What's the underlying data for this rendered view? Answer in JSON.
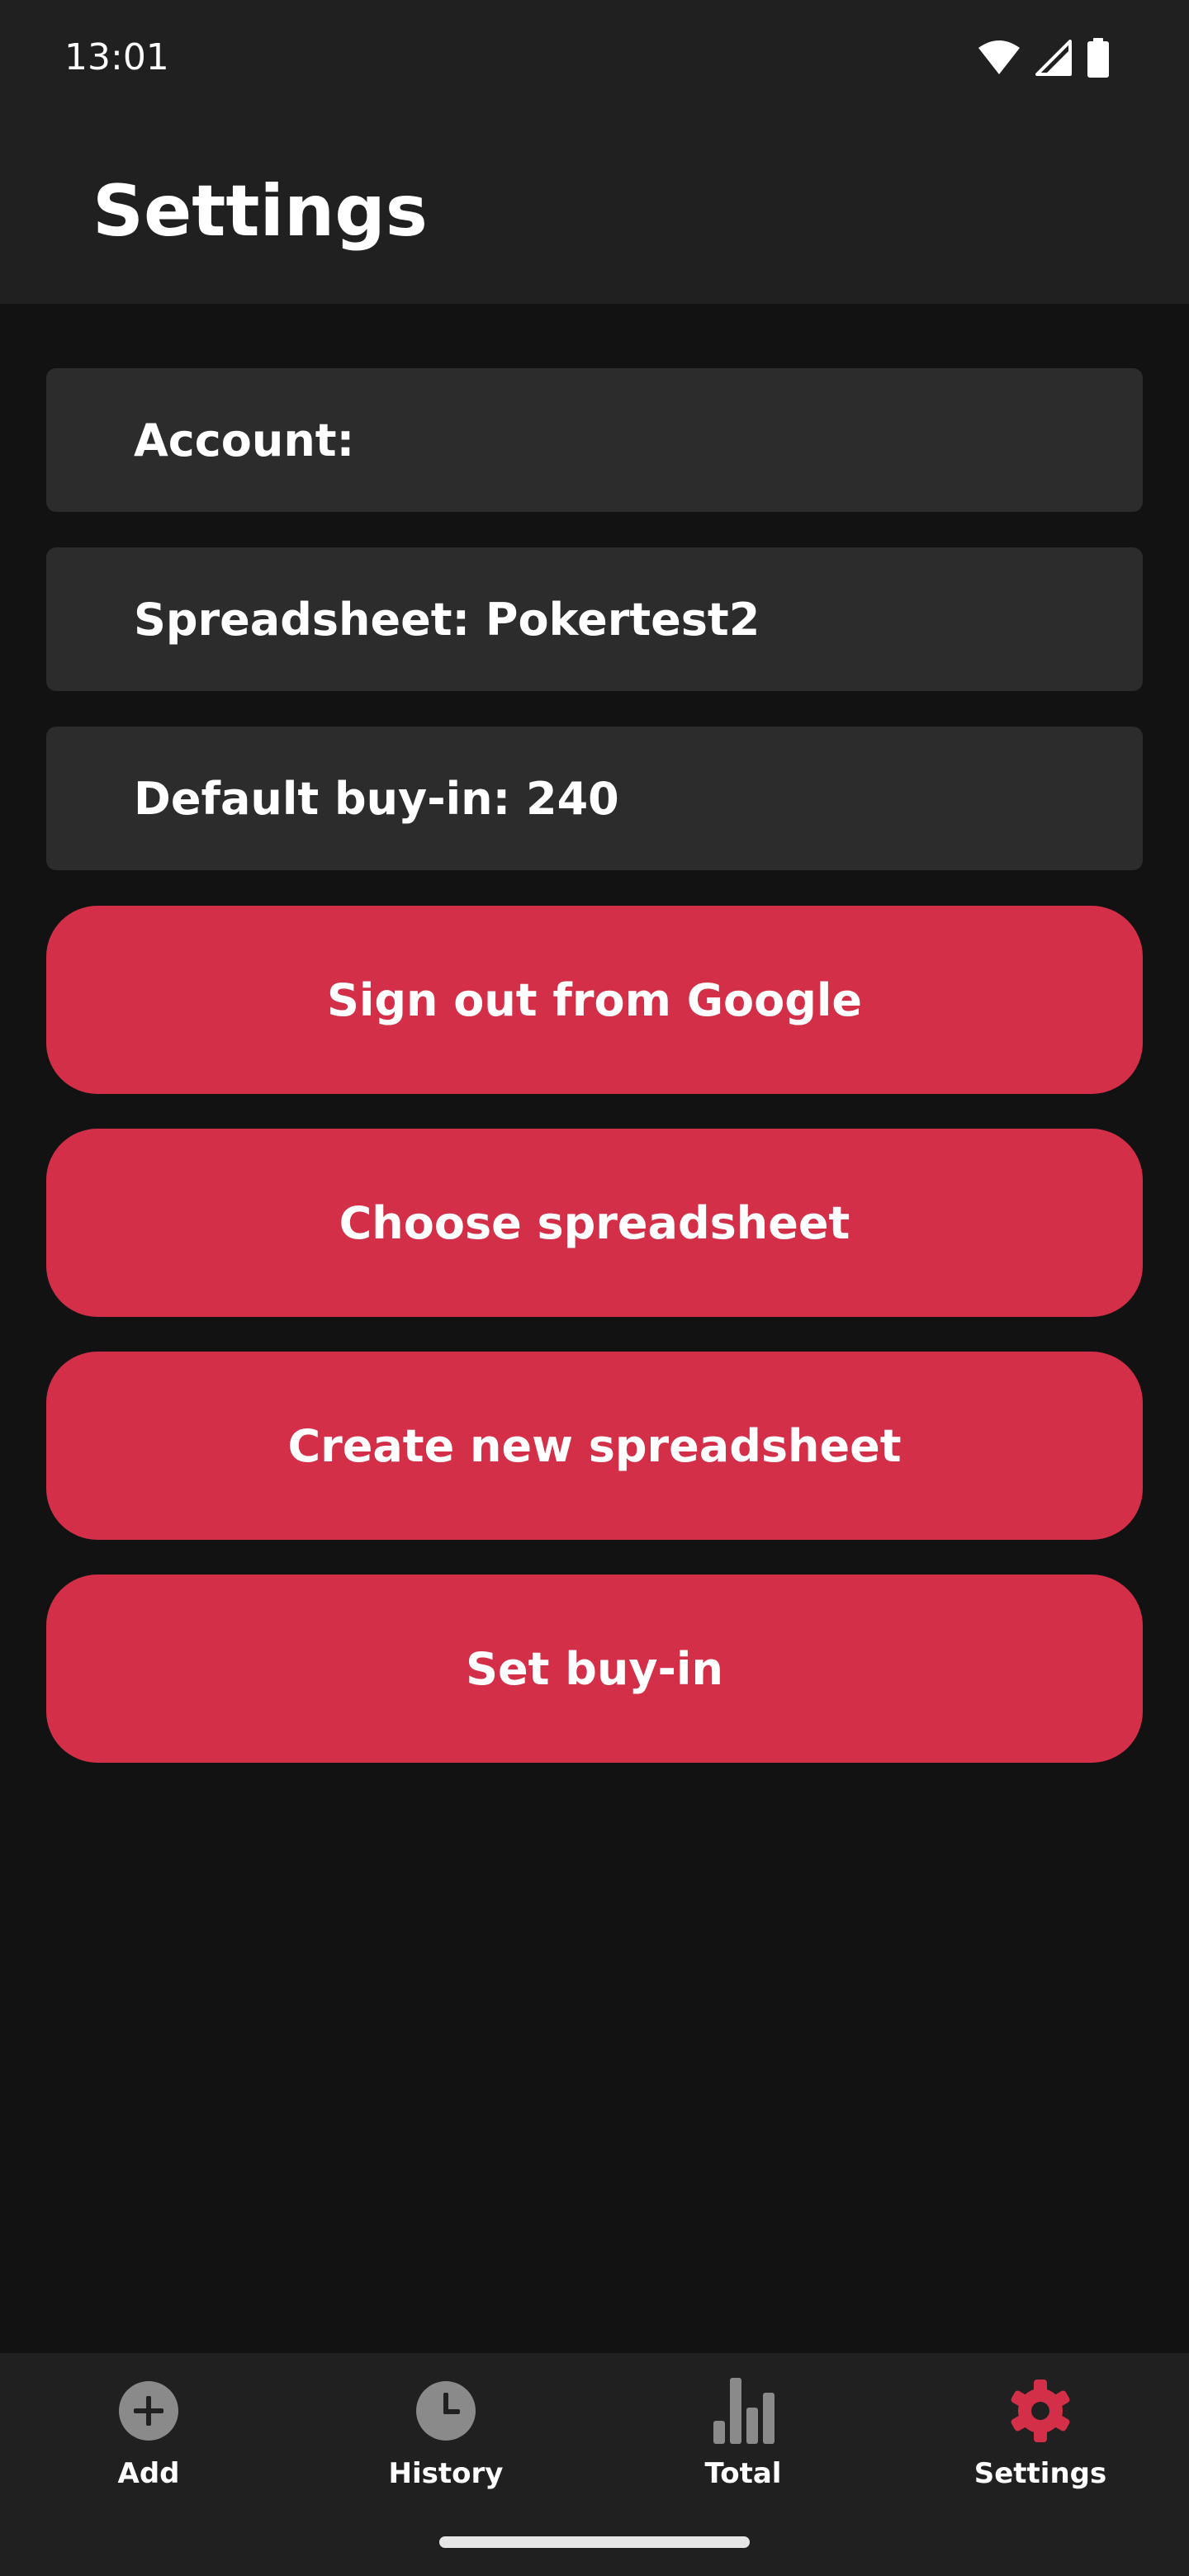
{
  "status_bar": {
    "time": "13:01"
  },
  "app_bar": {
    "title": "Settings"
  },
  "info": {
    "account": "Account: ",
    "spreadsheet": "Spreadsheet: Pokertest2",
    "default_buy_in": "Default buy-in: 240"
  },
  "buttons": {
    "sign_out": "Sign out from Google",
    "choose_spreadsheet": "Choose spreadsheet",
    "create_spreadsheet": "Create new spreadsheet",
    "set_buy_in": "Set buy-in"
  },
  "bottom_nav": {
    "items": [
      {
        "label": "Add",
        "icon": "plus-circle-icon",
        "active": false
      },
      {
        "label": "History",
        "icon": "clock-icon",
        "active": false
      },
      {
        "label": "Total",
        "icon": "bar-chart-icon",
        "active": false
      },
      {
        "label": "Settings",
        "icon": "gear-icon",
        "active": true
      }
    ]
  },
  "colors": {
    "background": "#121212",
    "surface": "#202020",
    "card": "#2c2c2c",
    "accent": "#d42f48",
    "inactive_icon": "#8a8a8a"
  }
}
